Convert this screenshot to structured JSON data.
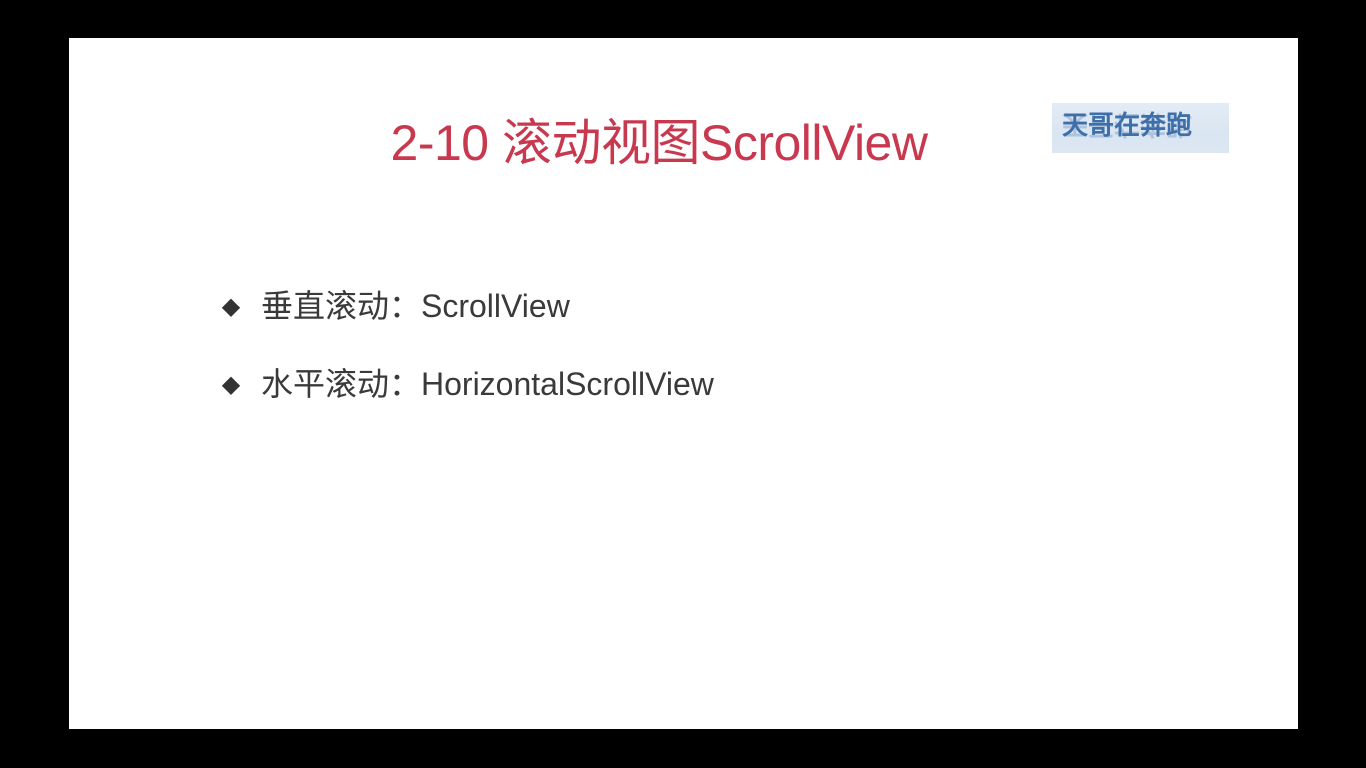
{
  "slide": {
    "title": "2-10 滚动视图ScrollView",
    "watermark": "天哥在奔跑",
    "bullets": [
      {
        "marker": "◆",
        "text": "垂直滚动：ScrollView"
      },
      {
        "marker": "◆",
        "text": "水平滚动：HorizontalScrollView"
      }
    ]
  },
  "colors": {
    "title": "#c8394f",
    "watermark_text": "#3f6fa8",
    "watermark_bg": "#dde7f2",
    "body_text": "#3a3a3a",
    "letterbox": "#000000",
    "slide_bg": "#ffffff"
  }
}
